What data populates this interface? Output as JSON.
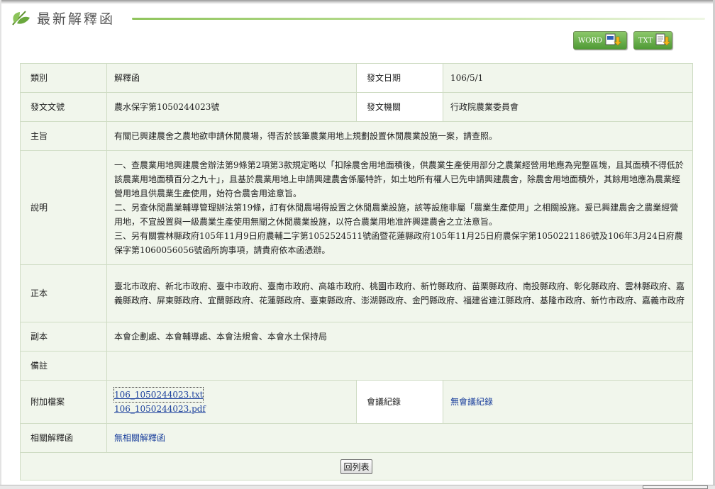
{
  "header": {
    "title": "最新解釋函",
    "word_button": "WORD",
    "txt_button": "TXT"
  },
  "detail": {
    "category_label": "類別",
    "category_value": "解釋函",
    "issue_date_label": "發文日期",
    "issue_date_value": "106/5/1",
    "doc_no_label": "發文文號",
    "doc_no_value": "農水保字第1050244023號",
    "agency_label": "發文機關",
    "agency_value": "行政院農業委員會",
    "subject_label": "主旨",
    "subject_value": "有關已興建農舍之農地欲申請休閒農場，得否於該筆農業用地上規劃設置休閒農業設施一案，請查照。",
    "explain_label": "說明",
    "explain_lines": [
      "一、查農業用地興建農舍辦法第9條第2項第3款規定略以「扣除農舍用地面積後，供農業生產使用部分之農業經營用地應為完整區塊，且其面積不得低於該農業用地面積百分之九十」，且基於農業用地上申請興建農舍係屬特許，如土地所有權人已先申請興建農舍，除農舍用地面積外，其餘用地應為農業經營用地且供農業生產使用，始符合農舍用途意旨。",
      "二、另查休閒農業輔導管理辦法第19條，訂有休閒農場得設置之休閒農業設施，該等設施非屬「農業生產使用」之相關設施。爰已興建農舍之農業經營用地，不宜設置與一級農業生產使用無關之休閒農業設施，以符合農業用地准許興建農舍之立法意旨。",
      "三、另有關雲林縣政府105年11月9日府農輔二字第1052524511號函暨花蓮縣政府105年11月25日府農保字第1050221186號及106年3月24日府農保字第1060056056號函所詢事項，請貴府依本函憑辦。"
    ],
    "original_label": "正本",
    "original_value": "臺北市政府、新北市政府、臺中市政府、臺南市政府、高雄市政府、桃園市政府、新竹縣政府、苗栗縣政府、南投縣政府、彰化縣政府、雲林縣政府、嘉義縣政府、屏東縣政府、宜蘭縣政府、花蓮縣政府、臺東縣政府、澎湖縣政府、金門縣政府、福建省連江縣政府、基隆市政府、新竹市政府、嘉義市政府",
    "copy_label": "副本",
    "copy_value": "本會企劃處、本會輔導處、本會法規會、本會水土保持局",
    "remarks_label": "備註",
    "remarks_value": "",
    "attachments_label": "附加檔案",
    "attachments": [
      "106_1050244023.txt",
      "106_1050244023.pdf"
    ],
    "meeting_label": "會議紀錄",
    "meeting_value": "無會議紀錄",
    "related_label": "相關解釋函",
    "related_value": "無相關解釋函"
  },
  "footer": {
    "back_button": "回列表"
  },
  "colors": {
    "accent_green": "#8fc45c",
    "cell_bg": "#f1f6ec",
    "link_blue": "#1a3f9c"
  }
}
